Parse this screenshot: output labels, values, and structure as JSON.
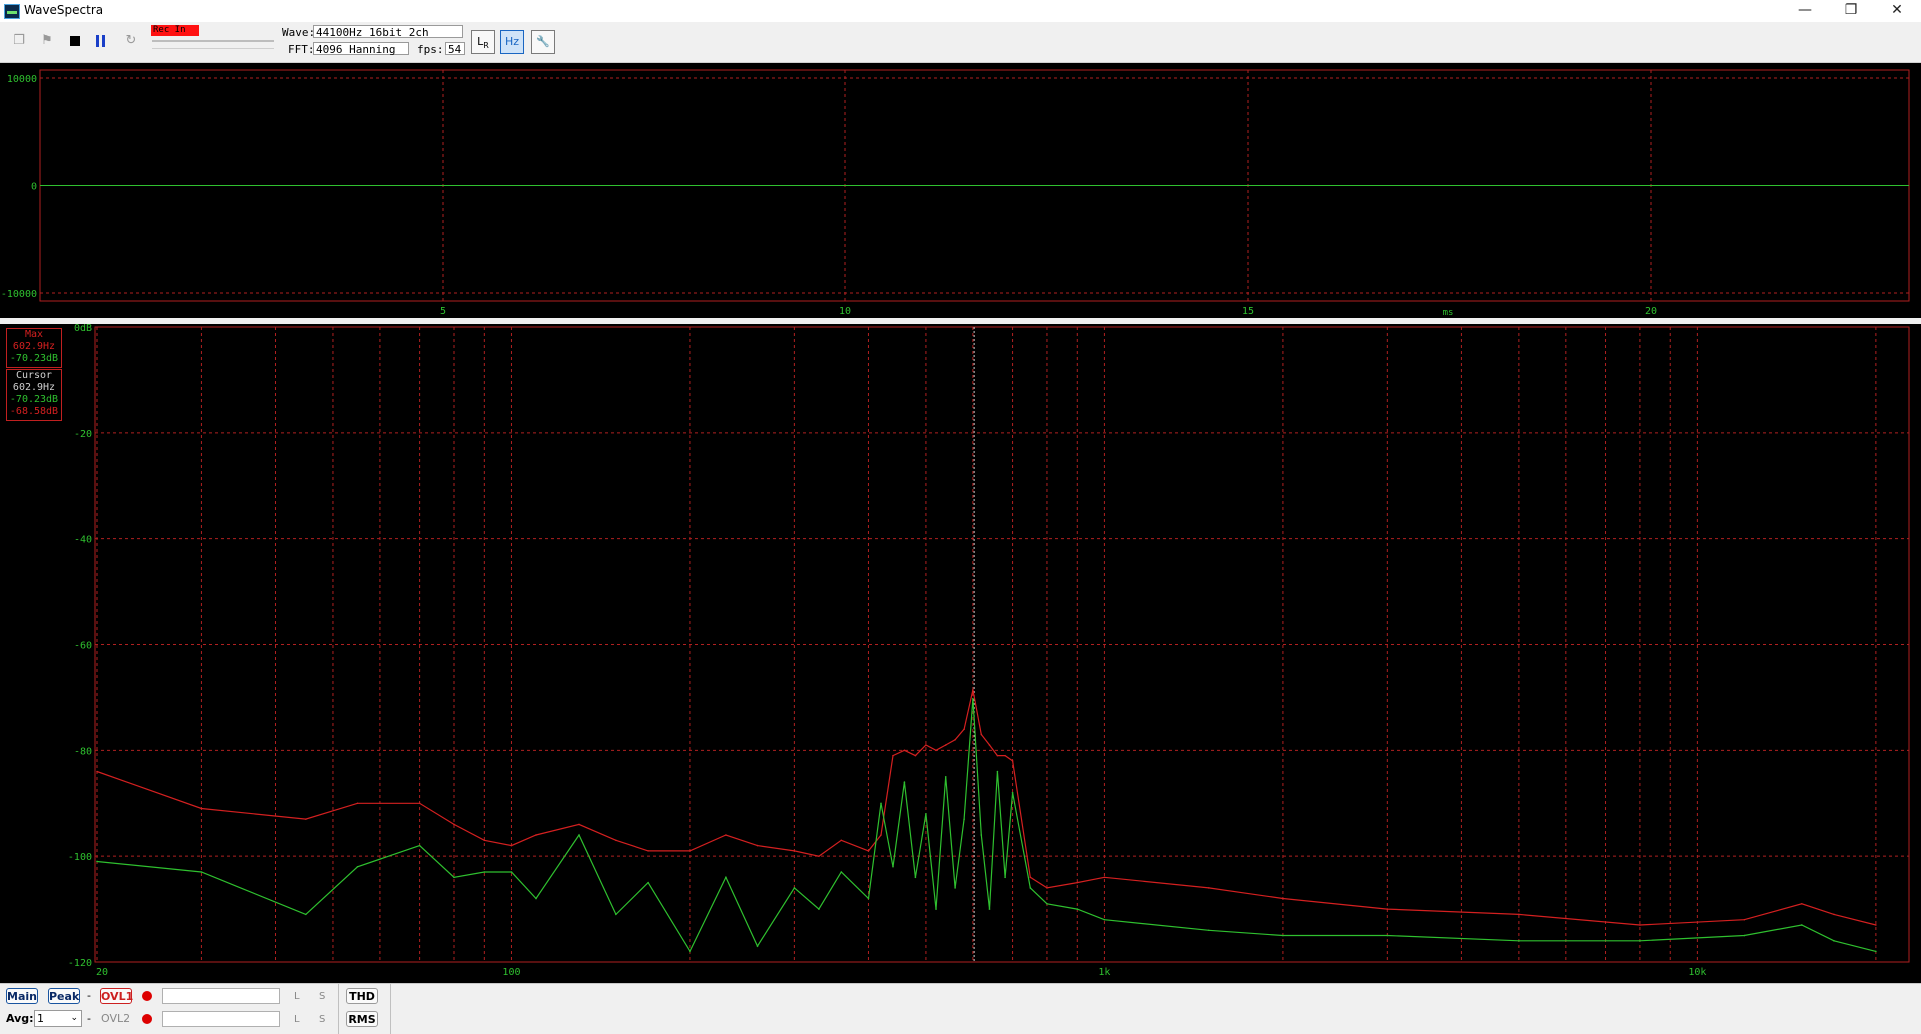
{
  "window": {
    "title": "WaveSpectra",
    "minimize": "—",
    "restore": "❐",
    "close": "✕"
  },
  "toolbar": {
    "rec_label": "Rec In",
    "wave_label": "Wave:",
    "wave_value": "44100Hz 16bit 2ch",
    "fft_label": "FFT:",
    "fft_value": "4096 Hanning",
    "fps_label": "fps:",
    "fps_value": "54",
    "icons": [
      "copy-icon",
      "flag-icon",
      "stop-icon",
      "pause-icon",
      "refresh-icon",
      "lr-channel-icon",
      "hz-scale-icon",
      "wrench-icon"
    ]
  },
  "wave_panel": {
    "y_ticks": [
      "10000",
      "0",
      "-10000"
    ],
    "x_ticks": [
      "5",
      "10",
      "15",
      "20"
    ],
    "x_unit": "ms",
    "line_color": "#2fc02f"
  },
  "spectrum_panel": {
    "legend": {
      "max_title": "Max",
      "max_freq": "602.9Hz",
      "max_db": "-70.23dB",
      "cursor_title": "Cursor",
      "cursor_freq": "602.9Hz",
      "cursor_db_green": "-70.23dB",
      "cursor_db_red": "-68.58dB"
    },
    "y_ticks": [
      "0dB",
      "-20",
      "-40",
      "-60",
      "-80",
      "-100",
      "-120"
    ],
    "x_ticks": [
      "20",
      "100",
      "1k",
      "10k"
    ],
    "colors": {
      "left": "#2fc02f",
      "right": "#d42020",
      "grid": "#b02020",
      "cursor": "#cfcfcf"
    }
  },
  "chart_data": {
    "type": "line",
    "x_scale": "log",
    "xlim": [
      20,
      22050
    ],
    "ylim": [
      -120,
      0
    ],
    "xlabel": "",
    "ylabel": "",
    "cursor_freq": 602.9,
    "series": [
      {
        "x": [
          20,
          30,
          45,
          55,
          70,
          80,
          90,
          100,
          110,
          130,
          150,
          170,
          200,
          230,
          260,
          300,
          330,
          360,
          400,
          420,
          440,
          460,
          480,
          500,
          520,
          540,
          560,
          580,
          600,
          620,
          640,
          660,
          680,
          700,
          750,
          800,
          900,
          1000,
          1500,
          2000,
          3000,
          5000,
          8000,
          12000,
          15000,
          17000,
          20000
        ],
        "y": [
          -84,
          -91,
          -93,
          -90,
          -90,
          -94,
          -97,
          -98,
          -96,
          -94,
          -97,
          -99,
          -99,
          -96,
          -98,
          -99,
          -100,
          -97,
          -99,
          -96,
          -81,
          -80,
          -81,
          -79,
          -80,
          -79,
          -78,
          -76,
          -68.58,
          -77,
          -79,
          -81,
          -81,
          -82,
          -104,
          -106,
          -105,
          -104,
          -106,
          -108,
          -110,
          -111,
          -113,
          -112,
          -109,
          -111,
          -113
        ]
      },
      {
        "x": [
          20,
          30,
          45,
          55,
          70,
          80,
          90,
          100,
          110,
          130,
          150,
          170,
          200,
          230,
          260,
          300,
          330,
          360,
          400,
          420,
          440,
          460,
          480,
          500,
          520,
          540,
          560,
          580,
          600,
          620,
          640,
          660,
          680,
          700,
          750,
          800,
          900,
          1000,
          1500,
          2000,
          3000,
          5000,
          8000,
          12000,
          15000,
          17000,
          20000
        ],
        "y": [
          -101,
          -103,
          -111,
          -102,
          -98,
          -104,
          -103,
          -103,
          -108,
          -96,
          -111,
          -105,
          -118,
          -104,
          -117,
          -106,
          -110,
          -103,
          -108,
          -90,
          -102,
          -86,
          -104,
          -92,
          -110,
          -85,
          -106,
          -93,
          -70.23,
          -96,
          -110,
          -84,
          -104,
          -88,
          -106,
          -109,
          -110,
          -112,
          -114,
          -115,
          -115,
          -116,
          -116,
          -115,
          -113,
          -116,
          -118
        ]
      }
    ]
  },
  "status": {
    "main_label": "Main",
    "peak_label": "Peak",
    "dash1": "-",
    "ovl1_label": "OVL1",
    "l1": "L",
    "s1": "S",
    "thd_label": "THD",
    "avg_label": "Avg:",
    "avg_value": "1",
    "dash2": "-",
    "ovl2_label": "OVL2",
    "l2": "L",
    "s2": "S",
    "rms_label": "RMS"
  }
}
